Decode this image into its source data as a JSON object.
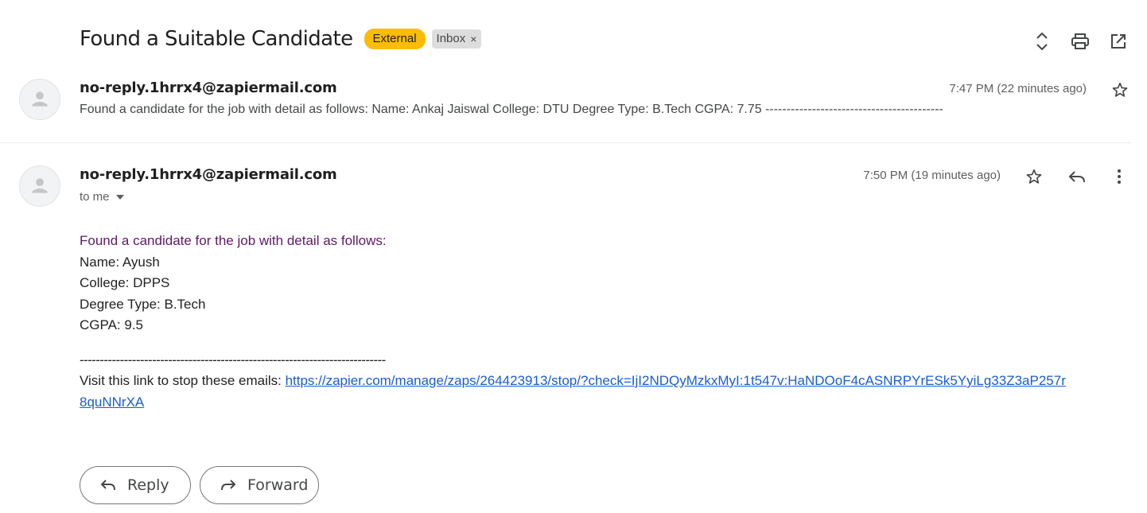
{
  "subject": "Found a Suitable Candidate",
  "labels": {
    "external": "External",
    "inbox": "Inbox",
    "inbox_remove": "×"
  },
  "colors": {
    "external_badge": "#fbbc04",
    "inbox_badge": "#dddddd",
    "link": "#1a5dcc",
    "intro_text": "#5f1767"
  },
  "header_icons": [
    "expand-collapse-icon",
    "print-icon",
    "open-in-new-window-icon"
  ],
  "collapsed_message": {
    "sender": "no-reply.1hrrx4@zapiermail.com",
    "snippet": "Found a candidate for the job with detail as follows: Name: Ankaj Jaiswal College: DTU Degree Type: B.Tech CGPA: 7.75 ------------------------------------------",
    "time": "7:47 PM (22 minutes ago)"
  },
  "expanded_message": {
    "sender": "no-reply.1hrrx4@zapiermail.com",
    "to": "to me",
    "time": "7:50 PM (19 minutes ago)",
    "body": {
      "intro": "Found a candidate for the job with detail as follows:",
      "name": "Name: Ayush",
      "college": "College: DPPS",
      "degree": "Degree Type: B.Tech",
      "cgpa": "CGPA: 9.5",
      "separator": "----------------------------------------------------------------------------",
      "stop_text": "Visit this link to stop these emails: ",
      "stop_link": "https://zapier.com/manage/zaps/264423913/stop/?check=IjI2NDQyMzkxMyI:1t547v:HaNDOoF4cASNRPYrESk5YyiLg33Z3aP257r8quNNrXA"
    }
  },
  "actions": {
    "reply": "Reply",
    "forward": "Forward"
  }
}
